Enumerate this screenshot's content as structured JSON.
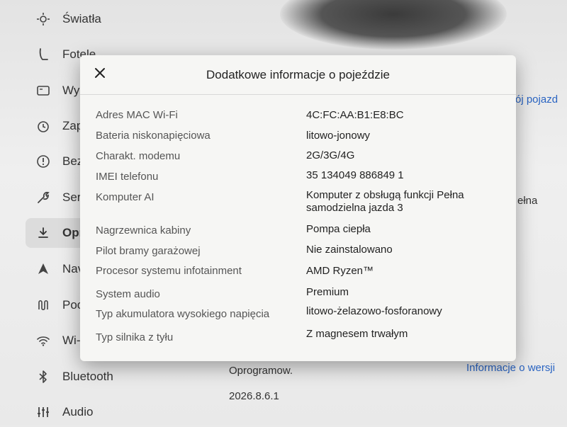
{
  "sidebar": {
    "items": [
      {
        "label": "Światła",
        "icon": "light-icon"
      },
      {
        "label": "Fotele",
        "icon": "seat-icon"
      },
      {
        "label": "Wy",
        "icon": "display-icon"
      },
      {
        "label": "Zap",
        "icon": "clock-icon"
      },
      {
        "label": "Bez",
        "icon": "alert-icon"
      },
      {
        "label": "Ser",
        "icon": "wrench-icon"
      },
      {
        "label": "Opr",
        "icon": "download-icon"
      },
      {
        "label": "Nav",
        "icon": "navigation-icon"
      },
      {
        "label": "Poc",
        "icon": "trip-icon"
      },
      {
        "label": "Wi-",
        "icon": "wifi-icon"
      },
      {
        "label": "Bluetooth",
        "icon": "bluetooth-icon"
      },
      {
        "label": "Audio",
        "icon": "equalizer-icon"
      }
    ]
  },
  "background": {
    "right_link_top": "ój pojazd",
    "right_text_mid": "ełna",
    "software_label": "Oprogramow.",
    "software_version": "2026.8.6.1",
    "version_info_link": "Informacje o wersji"
  },
  "modal": {
    "title": "Dodatkowe informacje o pojeździe",
    "rows": [
      {
        "label": "Adres MAC Wi-Fi",
        "value": "4C:FC:AA:B1:E8:BC"
      },
      {
        "label": "Bateria niskonapięciowa",
        "value": "litowo-jonowy"
      },
      {
        "label": "Charakt. modemu",
        "value": "2G/3G/4G"
      },
      {
        "label": "IMEI telefonu",
        "value": "35 134049 886849 1"
      },
      {
        "label": "Komputer AI",
        "value": "Komputer z obsługą funkcji Pełna samodzielna jazda 3"
      },
      {
        "label": "Nagrzewnica kabiny",
        "value": "Pompa ciepła"
      },
      {
        "label": "Pilot bramy garażowej",
        "value": "Nie zainstalowano"
      },
      {
        "label": "Procesor systemu infotainment",
        "value": "AMD Ryzen™"
      },
      {
        "label": "System audio",
        "value": "Premium"
      },
      {
        "label": "Typ akumulatora wysokiego napięcia",
        "value": "litowo-żelazowo-fosforanowy"
      },
      {
        "label": "Typ silnika z tyłu",
        "value": "Z magnesem trwałym"
      }
    ]
  }
}
